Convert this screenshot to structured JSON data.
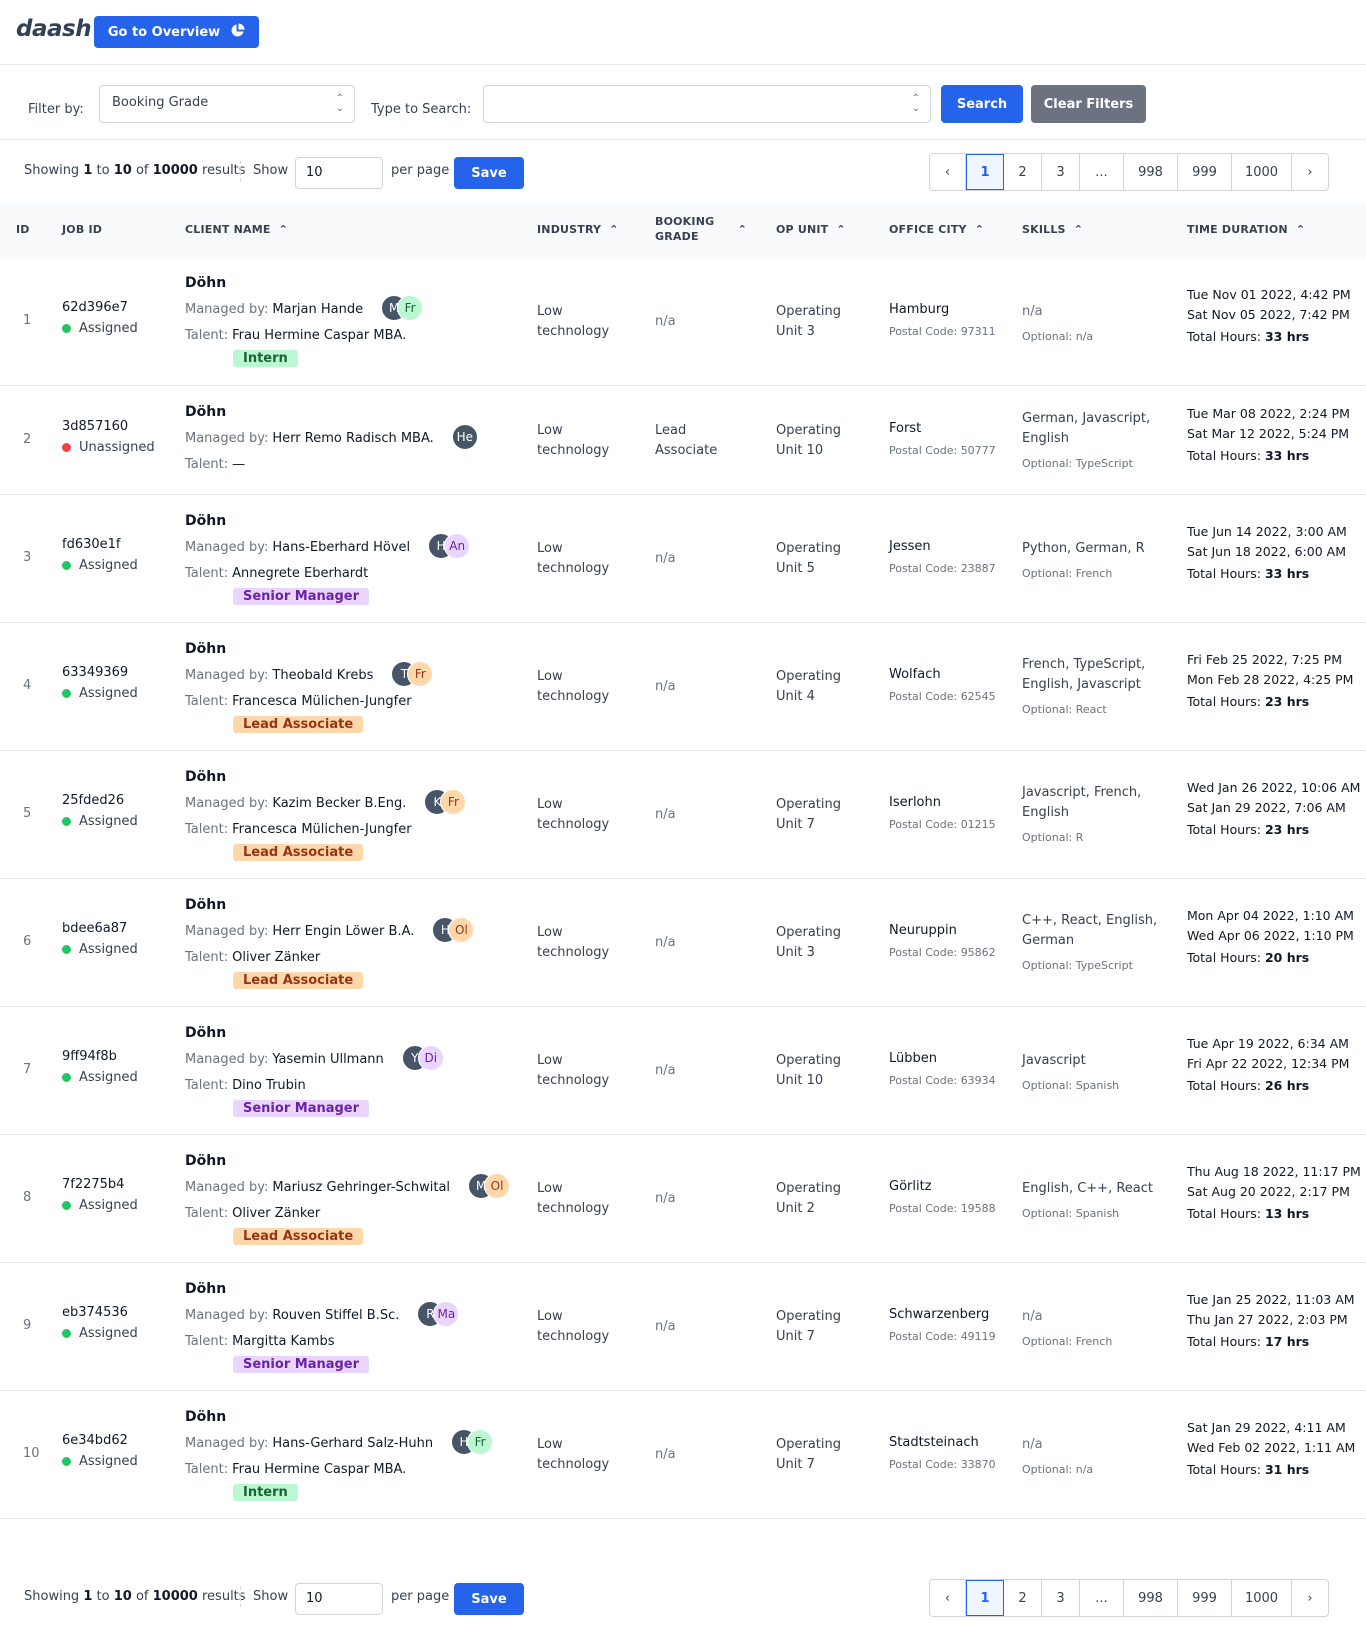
{
  "brand": {
    "logo": "daash",
    "overview_btn": "Go to Overview"
  },
  "filters": {
    "filter_label": "Filter by:",
    "filter_value": "Booking Grade",
    "search_label": "Type to Search:",
    "search_value": "",
    "search_btn": "Search",
    "clear_btn": "Clear Filters"
  },
  "paging": {
    "showing_prefix": "Showing",
    "from": "1",
    "to_word": "to",
    "to": "10",
    "of_word": "of",
    "total": "10000",
    "results_word": "results",
    "show_label": "Show",
    "per_page_value": "10",
    "per_page_label": "per page",
    "save_btn": "Save",
    "pages": [
      "1",
      "2",
      "3",
      "...",
      "998",
      "999",
      "1000"
    ],
    "prev": "‹",
    "next": "›"
  },
  "columns": {
    "id": "ID",
    "job_id": "JOB ID",
    "client_name": "CLIENT NAME",
    "industry": "INDUSTRY",
    "booking_grade_1": "BOOKING",
    "booking_grade_2": "GRADE",
    "op_unit": "OP UNIT",
    "office_city": "OFFICE CITY",
    "skills": "SKILLS",
    "time_duration": "TIME DURATION"
  },
  "labels": {
    "managed_by": "Managed by:",
    "talent": "Talent:",
    "postal_code": "Postal Code:",
    "optional": "Optional:",
    "total_hours": "Total Hours:"
  },
  "colors": {
    "primary": "#2563eb",
    "assigned": "#22c55e",
    "unassigned": "#ef4444",
    "intern_bg": "#bbf7d0",
    "intern_fg": "#166534",
    "senior_bg": "#e9d5ff",
    "senior_fg": "#6b21a8",
    "lead_bg": "#fed7aa",
    "lead_fg": "#9a3412"
  },
  "rows": [
    {
      "id": "1",
      "job_id": "62d396e7",
      "status": "Assigned",
      "client": "Döhn",
      "manager": "Marjan Hande",
      "av1": "M",
      "av2": "Fr",
      "talent": "Frau Hermine Caspar MBA.",
      "badge": "Intern",
      "industry1": "Low",
      "industry2": "technology",
      "grade1": "n/a",
      "grade2": "",
      "op1": "Operating",
      "op2": "Unit 3",
      "city": "Hamburg",
      "postal": "97311",
      "skills1": "n/a",
      "skills2": "",
      "optional": "n/a",
      "start": "Tue Nov 01 2022, 4:42 PM",
      "end": "Sat Nov 05 2022, 7:42 PM",
      "hours": "33 hrs"
    },
    {
      "id": "2",
      "job_id": "3d857160",
      "status": "Unassigned",
      "client": "Döhn",
      "manager": "Herr Remo Radisch MBA.",
      "av1": "He",
      "av2": "",
      "talent": "—",
      "badge": "",
      "industry1": "Low",
      "industry2": "technology",
      "grade1": "Lead",
      "grade2": "Associate",
      "op1": "Operating",
      "op2": "Unit 10",
      "city": "Forst",
      "postal": "50777",
      "skills1": "German, Javascript,",
      "skills2": "English",
      "optional": "TypeScript",
      "start": "Tue Mar 08 2022, 2:24 PM",
      "end": "Sat Mar 12 2022, 5:24 PM",
      "hours": "33 hrs"
    },
    {
      "id": "3",
      "job_id": "fd630e1f",
      "status": "Assigned",
      "client": "Döhn",
      "manager": "Hans-Eberhard Hövel",
      "av1": "H",
      "av2": "An",
      "talent": "Annegrete Eberhardt",
      "badge": "Senior Manager",
      "industry1": "Low",
      "industry2": "technology",
      "grade1": "n/a",
      "grade2": "",
      "op1": "Operating",
      "op2": "Unit 5",
      "city": "Jessen",
      "postal": "23887",
      "skills1": "Python, German, R",
      "skills2": "",
      "optional": "French",
      "start": "Tue Jun 14 2022, 3:00 AM",
      "end": "Sat Jun 18 2022, 6:00 AM",
      "hours": "33 hrs"
    },
    {
      "id": "4",
      "job_id": "63349369",
      "status": "Assigned",
      "client": "Döhn",
      "manager": "Theobald Krebs",
      "av1": "T",
      "av2": "Fr",
      "talent": "Francesca Mülichen-Jungfer",
      "badge": "Lead Associate",
      "industry1": "Low",
      "industry2": "technology",
      "grade1": "n/a",
      "grade2": "",
      "op1": "Operating",
      "op2": "Unit 4",
      "city": "Wolfach",
      "postal": "62545",
      "skills1": "French, TypeScript,",
      "skills2": "English, Javascript",
      "optional": "React",
      "start": "Fri Feb 25 2022, 7:25 PM",
      "end": "Mon Feb 28 2022, 4:25 PM",
      "hours": "23 hrs"
    },
    {
      "id": "5",
      "job_id": "25fded26",
      "status": "Assigned",
      "client": "Döhn",
      "manager": "Kazim Becker B.Eng.",
      "av1": "K",
      "av2": "Fr",
      "talent": "Francesca Mülichen-Jungfer",
      "badge": "Lead Associate",
      "industry1": "Low",
      "industry2": "technology",
      "grade1": "n/a",
      "grade2": "",
      "op1": "Operating",
      "op2": "Unit 7",
      "city": "Iserlohn",
      "postal": "01215",
      "skills1": "Javascript, French,",
      "skills2": "English",
      "optional": "R",
      "start": "Wed Jan 26 2022, 10:06 AM",
      "end": "Sat Jan 29 2022, 7:06 AM",
      "hours": "23 hrs"
    },
    {
      "id": "6",
      "job_id": "bdee6a87",
      "status": "Assigned",
      "client": "Döhn",
      "manager": "Herr Engin Löwer B.A.",
      "av1": "H",
      "av2": "Ol",
      "talent": "Oliver Zänker",
      "badge": "Lead Associate",
      "industry1": "Low",
      "industry2": "technology",
      "grade1": "n/a",
      "grade2": "",
      "op1": "Operating",
      "op2": "Unit 3",
      "city": "Neuruppin",
      "postal": "95862",
      "skills1": "C++, React, English,",
      "skills2": "German",
      "optional": "TypeScript",
      "start": "Mon Apr 04 2022, 1:10 AM",
      "end": "Wed Apr 06 2022, 1:10 PM",
      "hours": "20 hrs"
    },
    {
      "id": "7",
      "job_id": "9ff94f8b",
      "status": "Assigned",
      "client": "Döhn",
      "manager": "Yasemin Ullmann",
      "av1": "Y",
      "av2": "Di",
      "talent": "Dino Trubin",
      "badge": "Senior Manager",
      "industry1": "Low",
      "industry2": "technology",
      "grade1": "n/a",
      "grade2": "",
      "op1": "Operating",
      "op2": "Unit 10",
      "city": "Lübben",
      "postal": "63934",
      "skills1": "Javascript",
      "skills2": "",
      "optional": "Spanish",
      "start": "Tue Apr 19 2022, 6:34 AM",
      "end": "Fri Apr 22 2022, 12:34 PM",
      "hours": "26 hrs"
    },
    {
      "id": "8",
      "job_id": "7f2275b4",
      "status": "Assigned",
      "client": "Döhn",
      "manager": "Mariusz Gehringer-Schwital",
      "av1": "M",
      "av2": "Ol",
      "talent": "Oliver Zänker",
      "badge": "Lead Associate",
      "industry1": "Low",
      "industry2": "technology",
      "grade1": "n/a",
      "grade2": "",
      "op1": "Operating",
      "op2": "Unit 2",
      "city": "Görlitz",
      "postal": "19588",
      "skills1": "English, C++, React",
      "skills2": "",
      "optional": "Spanish",
      "start": "Thu Aug 18 2022, 11:17 PM",
      "end": "Sat Aug 20 2022, 2:17 PM",
      "hours": "13 hrs"
    },
    {
      "id": "9",
      "job_id": "eb374536",
      "status": "Assigned",
      "client": "Döhn",
      "manager": "Rouven Stiffel B.Sc.",
      "av1": "R",
      "av2": "Ma",
      "talent": "Margitta Kambs",
      "badge": "Senior Manager",
      "industry1": "Low",
      "industry2": "technology",
      "grade1": "n/a",
      "grade2": "",
      "op1": "Operating",
      "op2": "Unit 7",
      "city": "Schwarzenberg",
      "postal": "49119",
      "skills1": "n/a",
      "skills2": "",
      "optional": "French",
      "start": "Tue Jan 25 2022, 11:03 AM",
      "end": "Thu Jan 27 2022, 2:03 PM",
      "hours": "17 hrs"
    },
    {
      "id": "10",
      "job_id": "6e34bd62",
      "status": "Assigned",
      "client": "Döhn",
      "manager": "Hans-Gerhard Salz-Huhn",
      "av1": "H",
      "av2": "Fr",
      "talent": "Frau Hermine Caspar MBA.",
      "badge": "Intern",
      "industry1": "Low",
      "industry2": "technology",
      "grade1": "n/a",
      "grade2": "",
      "op1": "Operating",
      "op2": "Unit 7",
      "city": "Stadtsteinach",
      "postal": "33870",
      "skills1": "n/a",
      "skills2": "",
      "optional": "n/a",
      "start": "Sat Jan 29 2022, 4:11 AM",
      "end": "Wed Feb 02 2022, 1:11 AM",
      "hours": "31 hrs"
    }
  ]
}
